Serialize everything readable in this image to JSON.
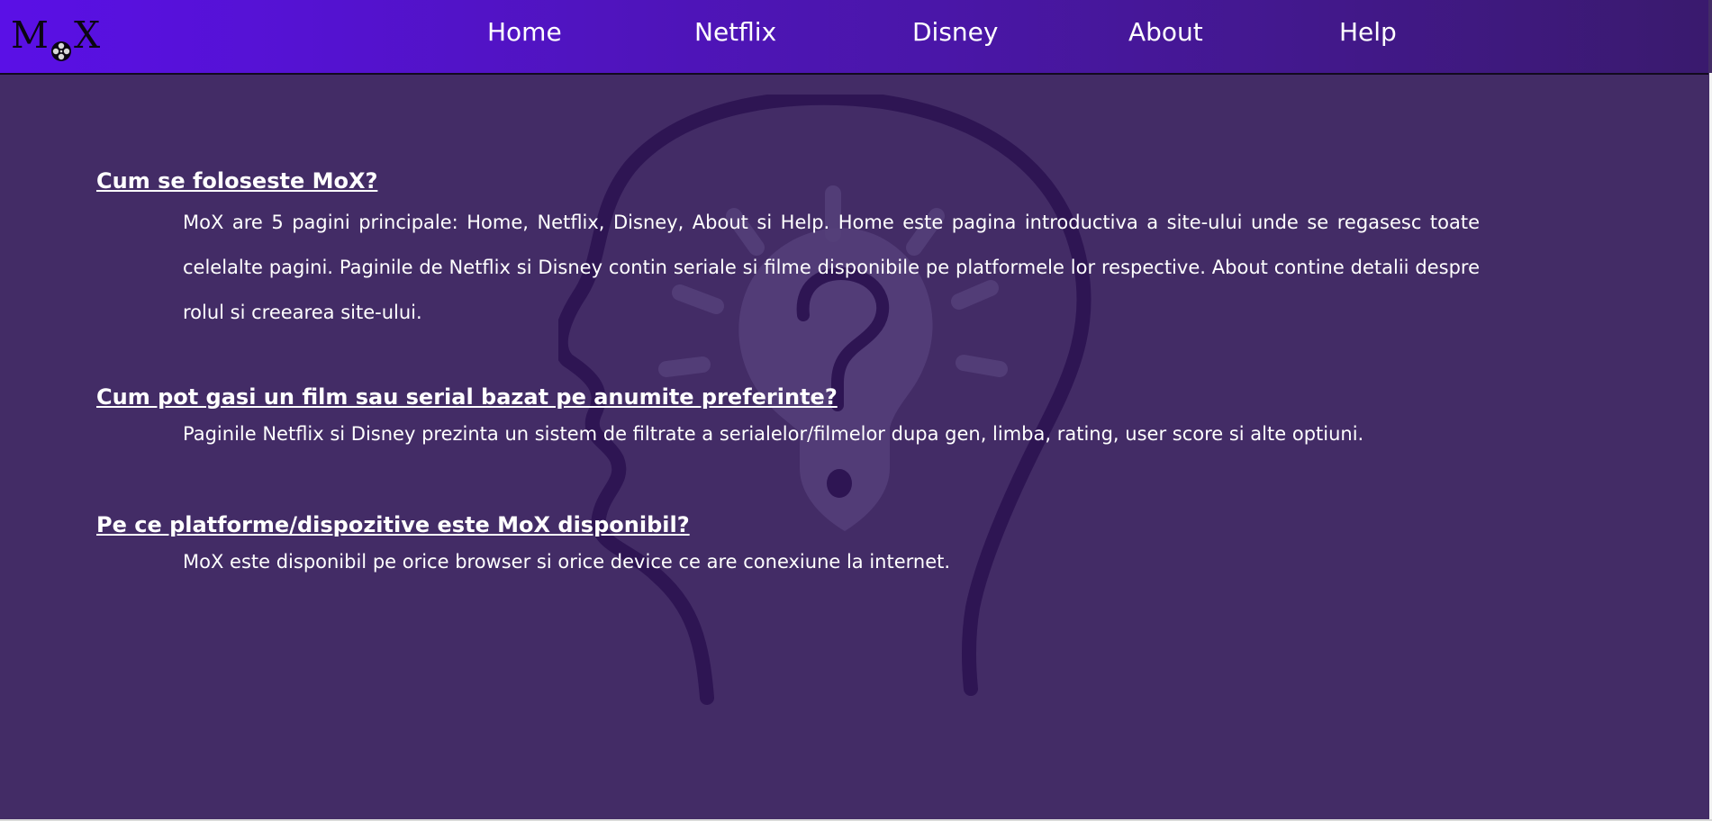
{
  "logo": {
    "text_left": "M",
    "text_right": "X",
    "icon": "film-reel-icon"
  },
  "nav": {
    "items": [
      {
        "label": "Home"
      },
      {
        "label": "Netflix"
      },
      {
        "label": "Disney"
      },
      {
        "label": "About"
      },
      {
        "label": "Help"
      }
    ]
  },
  "faq": [
    {
      "question": "Cum se foloseste MoX?",
      "answer": "MoX are 5 pagini principale: Home, Netflix, Disney, About si Help. Home este pagina introductiva a site-ului unde se regasesc toate celelalte pagini. Paginile de Netflix si Disney contin seriale si filme disponibile pe platformele lor respective. About contine detalii despre rolul si creearea site-ului."
    },
    {
      "question": "Cum pot gasi un film sau serial bazat pe anumite preferinte?",
      "answer": "Paginile Netflix si Disney prezinta un sistem de filtrate a serialelor/filmelor dupa gen, limba, rating, user score si alte optiuni."
    },
    {
      "question": "Pe ce platforme/dispozitive este MoX disponibil?",
      "answer": "MoX este disponibil pe orice browser si orice device ce are conexiune la internet."
    }
  ],
  "colors": {
    "background": "#432c66",
    "header_start": "#5a10e6",
    "header_end": "#3a1a6e",
    "text": "#ffffff"
  },
  "background_art": "head-lightbulb-question-icon"
}
